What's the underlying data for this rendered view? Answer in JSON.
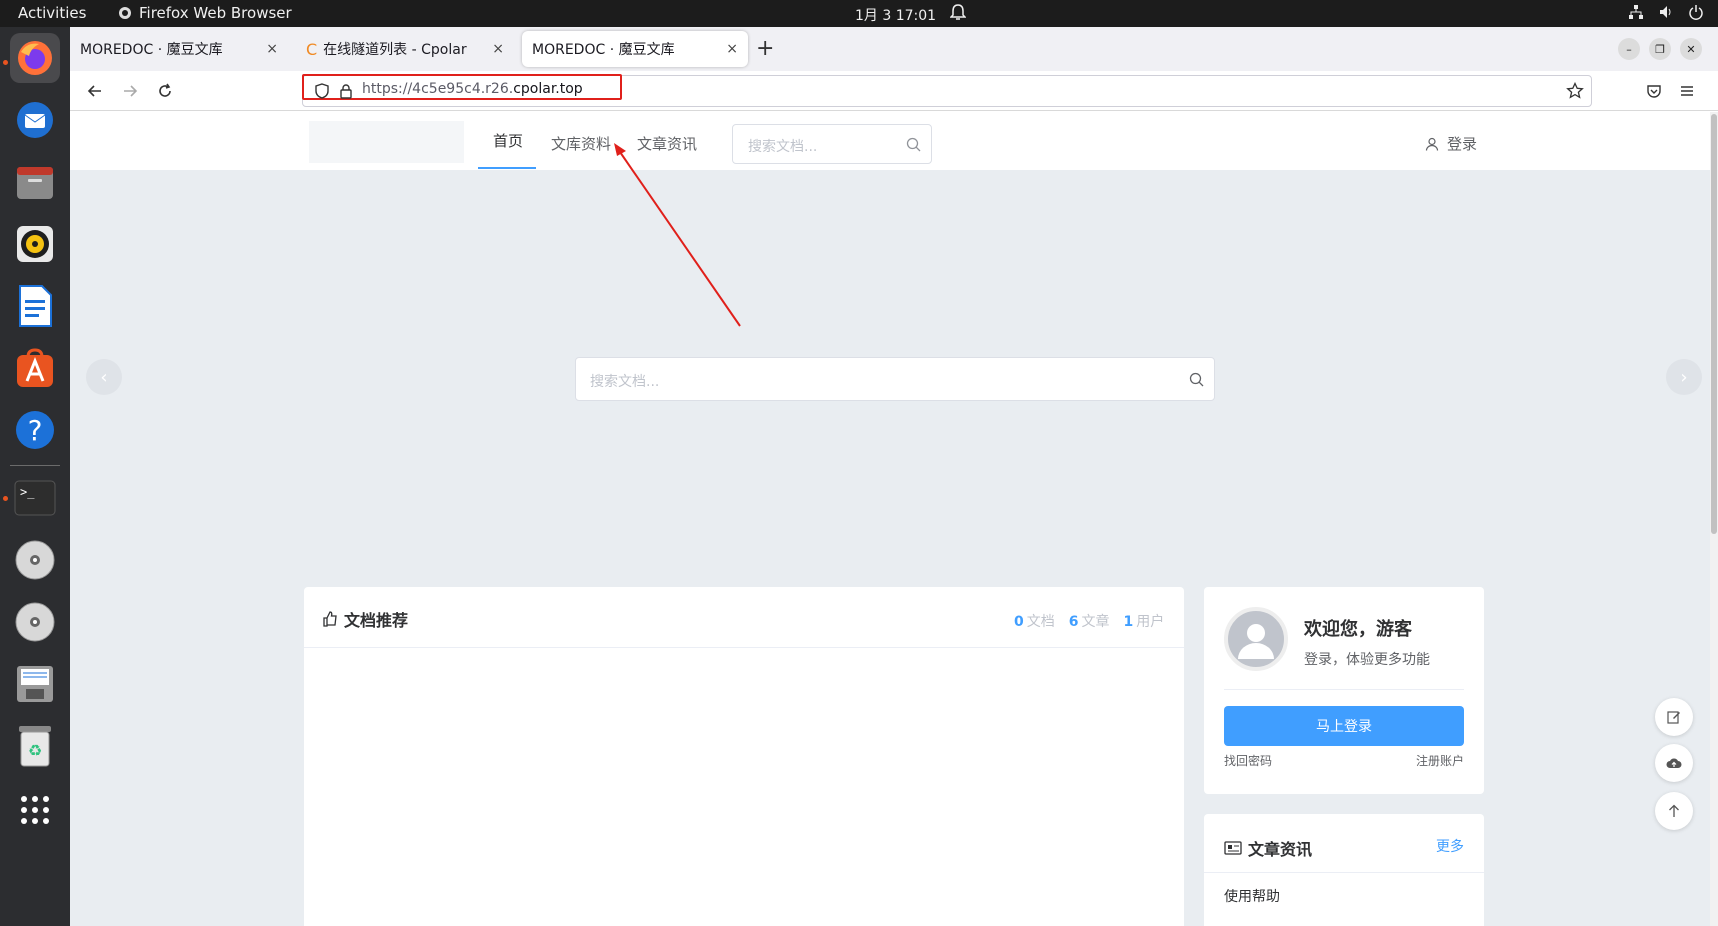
{
  "topbar": {
    "activities": "Activities",
    "app_name": "Firefox Web Browser",
    "clock": "1月 3  17:01"
  },
  "dock": {
    "apps": [
      "firefox-icon",
      "thunderbird-icon",
      "files-icon",
      "rhythmbox-icon",
      "writer-icon",
      "app-center-icon",
      "help-icon",
      "terminal-icon",
      "disc-icon",
      "disc-icon",
      "save-icon",
      "trash-icon",
      "apps-grid-icon"
    ]
  },
  "browser": {
    "tabs": [
      {
        "title": "MOREDOC · 魔豆文库",
        "favicon": ""
      },
      {
        "title": "在线隧道列表 - Cpolar",
        "favicon": "C"
      },
      {
        "title": "MOREDOC · 魔豆文库",
        "favicon": ""
      }
    ],
    "close_glyph": "×",
    "new_tab": "+",
    "url_prefix": "https://4c5e95c4.r26.",
    "url_domain": "cpolar.top"
  },
  "site": {
    "menu": [
      "首页",
      "文库资料",
      "文章资讯"
    ],
    "header_search_placeholder": "搜索文档...",
    "login": "登录",
    "banner_search_placeholder": "搜索文档..."
  },
  "recommend": {
    "title": "文档推荐",
    "stats": [
      {
        "count": "0",
        "label": "文档"
      },
      {
        "count": "6",
        "label": "文章"
      },
      {
        "count": "1",
        "label": "用户"
      }
    ]
  },
  "user_card": {
    "welcome": "欢迎您，游客",
    "sub": "登录，体验更多功能",
    "login_button": "马上登录",
    "forgot": "找回密码",
    "register": "注册账户"
  },
  "articles": {
    "title": "文章资讯",
    "more": "更多",
    "first_item": "使用帮助"
  },
  "colors": {
    "primary": "#409eff",
    "annotation": "#e0201b"
  }
}
